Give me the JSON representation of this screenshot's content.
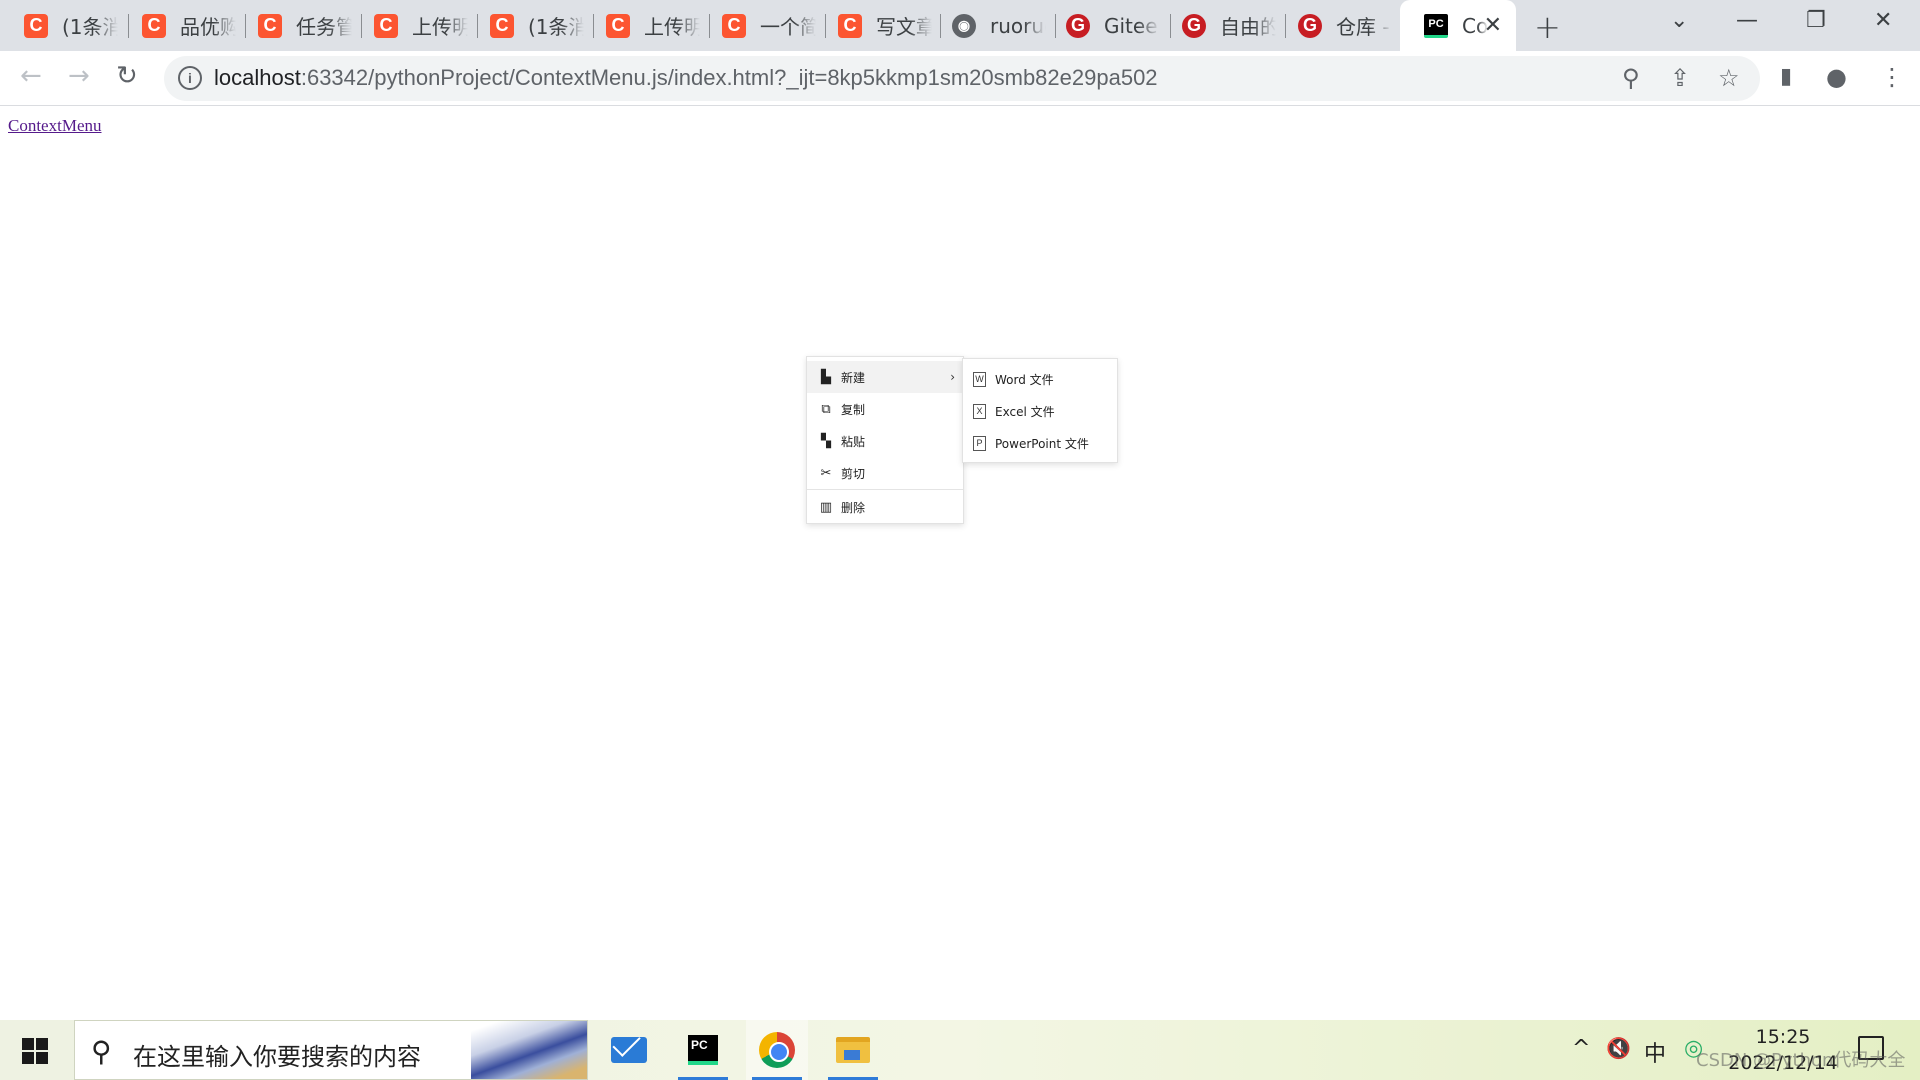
{
  "browser": {
    "tabs": [
      {
        "icon": "csdn",
        "icon_glyph": "C",
        "title": "(1条消息"
      },
      {
        "icon": "csdn",
        "icon_glyph": "C",
        "title": "品优购"
      },
      {
        "icon": "csdn",
        "icon_glyph": "C",
        "title": "任务管"
      },
      {
        "icon": "csdn",
        "icon_glyph": "C",
        "title": "上传明"
      },
      {
        "icon": "csdn",
        "icon_glyph": "C",
        "title": "(1条消息"
      },
      {
        "icon": "csdn",
        "icon_glyph": "C",
        "title": "上传明"
      },
      {
        "icon": "csdn",
        "icon_glyph": "C",
        "title": "一个简"
      },
      {
        "icon": "csdn",
        "icon_glyph": "C",
        "title": "写文章"
      },
      {
        "icon": "globe",
        "icon_glyph": "◉",
        "title": "ruoruo"
      },
      {
        "icon": "gitee",
        "icon_glyph": "G",
        "title": "Gitee"
      },
      {
        "icon": "gitee",
        "icon_glyph": "G",
        "title": "自由的"
      },
      {
        "icon": "gitee",
        "icon_glyph": "G",
        "title": "仓库 -"
      },
      {
        "icon": "pycharm",
        "icon_glyph": "PC",
        "title": "Co",
        "active": true
      }
    ],
    "tab_close_glyph": "✕",
    "new_tab_glyph": "+",
    "window_controls": {
      "tab_search": "⌄",
      "minimize": "—",
      "restore": "❐",
      "close": "✕"
    },
    "toolbar": {
      "back": "←",
      "forward": "→",
      "reload": "↻"
    },
    "omnibox": {
      "info_glyph": "i",
      "host": "localhost",
      "path": ":63342/pythonProject/ContextMenu.js/index.html?_ijt=8kp5kkmp1sm20smb82e29pa502",
      "zoom_glyph": "⚲",
      "share_glyph": "⇪",
      "star_glyph": "☆"
    },
    "side_panel_glyph": "▮",
    "profile_glyph": "●",
    "menu_glyph": "⋮"
  },
  "page": {
    "link_text": "ContextMenu"
  },
  "context_menu": {
    "items": [
      {
        "icon": "file",
        "glyph": "▙",
        "label": "新建",
        "has_submenu": true,
        "arrow": "›"
      },
      {
        "icon": "copy",
        "glyph": "⧉",
        "label": "复制"
      },
      {
        "icon": "paste",
        "glyph": "▚",
        "label": "粘贴"
      },
      {
        "icon": "scissors",
        "glyph": "✂",
        "label": "剪切"
      },
      {
        "icon": "trash",
        "glyph": "▥",
        "label": "删除"
      }
    ],
    "submenu": [
      {
        "icon": "word",
        "glyph": "W",
        "label": "Word 文件"
      },
      {
        "icon": "excel",
        "glyph": "X",
        "label": "Excel 文件"
      },
      {
        "icon": "powerpoint",
        "glyph": "P",
        "label": "PowerPoint 文件"
      }
    ]
  },
  "taskbar": {
    "search_placeholder": "在这里输入你要搜索的内容",
    "search_glyph": "⚲",
    "pycharm_label": "PC",
    "tray": {
      "chevron": "^",
      "volume": "🔇",
      "ime": "中",
      "wechat": "◎"
    },
    "time": "15:25",
    "date": "2022/12/14",
    "watermark": "CSDN @Python代码大全"
  }
}
